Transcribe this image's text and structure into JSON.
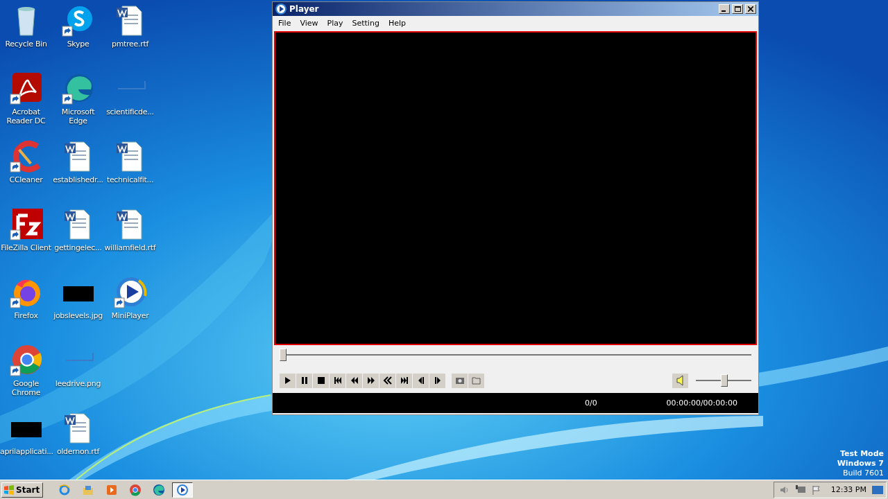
{
  "desktop_rows": [
    [
      {
        "label": "Recycle Bin",
        "kind": "recycle",
        "shortcut": false
      },
      {
        "label": "Skype",
        "kind": "skype",
        "shortcut": true
      },
      {
        "label": "pmtree.rtf",
        "kind": "word",
        "shortcut": false
      }
    ],
    [
      {
        "label": "Acrobat Reader DC",
        "kind": "acrobat",
        "shortcut": true
      },
      {
        "label": "Microsoft Edge",
        "kind": "edge",
        "shortcut": true
      },
      {
        "label": "scientificde...",
        "kind": "blank",
        "shortcut": false
      }
    ],
    [
      {
        "label": "CCleaner",
        "kind": "ccleaner",
        "shortcut": true
      },
      {
        "label": "establishedr...",
        "kind": "word",
        "shortcut": false
      },
      {
        "label": "technicalfit...",
        "kind": "word",
        "shortcut": false
      }
    ],
    [
      {
        "label": "FileZilla Client",
        "kind": "filezilla",
        "shortcut": true
      },
      {
        "label": "gettingelec...",
        "kind": "word",
        "shortcut": false
      },
      {
        "label": "williamfield.rtf",
        "kind": "word",
        "shortcut": false
      }
    ],
    [
      {
        "label": "Firefox",
        "kind": "firefox",
        "shortcut": true
      },
      {
        "label": "jobslevels.jpg",
        "kind": "dark",
        "shortcut": false
      },
      {
        "label": "MiniPlayer",
        "kind": "player",
        "shortcut": true
      }
    ],
    [
      {
        "label": "Google Chrome",
        "kind": "chrome",
        "shortcut": true
      },
      {
        "label": "leedrive.png",
        "kind": "blank",
        "shortcut": false
      }
    ],
    [
      {
        "label": "aprilapplicati...",
        "kind": "dark",
        "shortcut": false
      },
      {
        "label": "oldernon.rtf",
        "kind": "word",
        "shortcut": false
      }
    ]
  ],
  "window": {
    "title": "Player",
    "menu": [
      "File",
      "View",
      "Play",
      "Setting",
      "Help"
    ],
    "seek": {
      "level": 0
    },
    "buttons": [
      {
        "kind": "play"
      },
      {
        "kind": "pause"
      },
      {
        "kind": "stop"
      },
      {
        "kind": "prev"
      },
      {
        "kind": "rewind"
      },
      {
        "kind": "forward"
      },
      {
        "kind": "slow"
      },
      {
        "kind": "next"
      },
      {
        "kind": "frame-back"
      },
      {
        "kind": "frame-forward"
      }
    ],
    "tools": [
      {
        "kind": "snapshot"
      },
      {
        "kind": "open"
      }
    ],
    "volume": {
      "level": 0.52
    },
    "status": {
      "count": "0/0",
      "time": "00:00:00/00:00:00"
    }
  },
  "watermark_text": [
    "Test Mode",
    "Windows 7",
    "Build 7601"
  ],
  "taskbar": {
    "start": "Start",
    "apps": [
      {
        "kind": "ie",
        "selected": false
      },
      {
        "kind": "folder",
        "selected": false
      },
      {
        "kind": "media",
        "selected": false
      },
      {
        "kind": "chrome",
        "selected": false
      },
      {
        "kind": "edge",
        "selected": false
      },
      {
        "kind": "player",
        "selected": true
      }
    ],
    "clock": "12:33 PM"
  }
}
